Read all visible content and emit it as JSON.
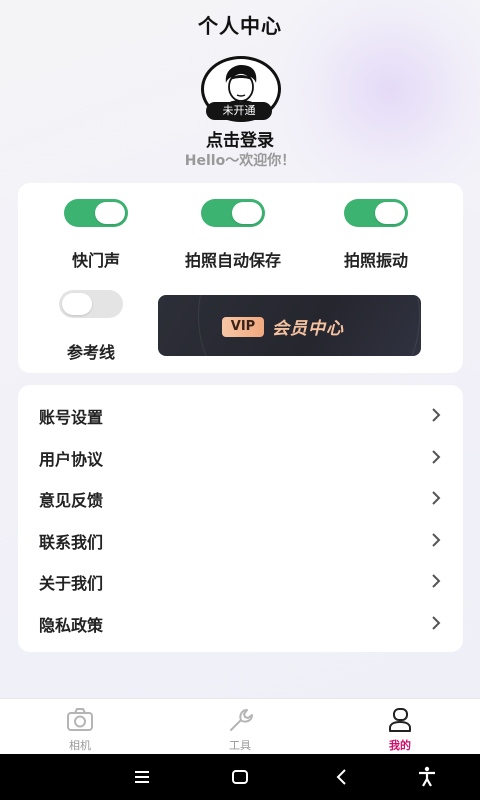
{
  "header": {
    "title": "个人中心"
  },
  "profile": {
    "badge": "未开通",
    "login_label": "点击登录",
    "greeting": "Hello～欢迎你！"
  },
  "settings": [
    {
      "label": "快门声",
      "enabled": true
    },
    {
      "label": "拍照自动保存",
      "enabled": true
    },
    {
      "label": "拍照振动",
      "enabled": true
    },
    {
      "label": "参考线",
      "enabled": false
    }
  ],
  "vip": {
    "badge": "VIP",
    "label": "会员中心"
  },
  "menu": [
    {
      "label": "账号设置"
    },
    {
      "label": "用户协议"
    },
    {
      "label": "意见反馈"
    },
    {
      "label": "联系我们"
    },
    {
      "label": "关于我们"
    },
    {
      "label": "隐私政策"
    }
  ],
  "tabs": [
    {
      "label": "相机",
      "icon": "camera-icon",
      "active": false
    },
    {
      "label": "工具",
      "icon": "wrench-icon",
      "active": false
    },
    {
      "label": "我的",
      "icon": "person-icon",
      "active": true
    }
  ],
  "colors": {
    "toggle_on": "#3cb371",
    "toggle_off": "#e4e4e4",
    "active_tab": "#d0106a",
    "vip_text": "#f5c29f"
  },
  "system_nav": [
    "menu-icon",
    "home-icon",
    "back-icon",
    "accessibility-icon"
  ]
}
